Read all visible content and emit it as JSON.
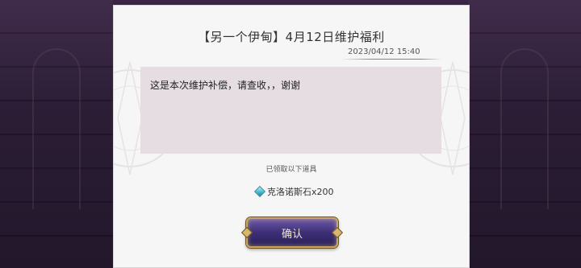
{
  "mail": {
    "title": "【另一个伊甸】4月12日维护福利",
    "date": "2023/04/12 15:40",
    "message": "这是本次维护补偿，请查收，，谢谢",
    "received_label": "已领取以下道具",
    "reward": {
      "icon": "chronos-stone-icon",
      "text": "克洛诺斯石x200"
    },
    "confirm_label": "确认"
  },
  "colors": {
    "panel_bg": "#f7f6f7",
    "message_bg": "#e6dde2",
    "button_bg": "#3c2e76",
    "button_border": "#caa55a"
  }
}
